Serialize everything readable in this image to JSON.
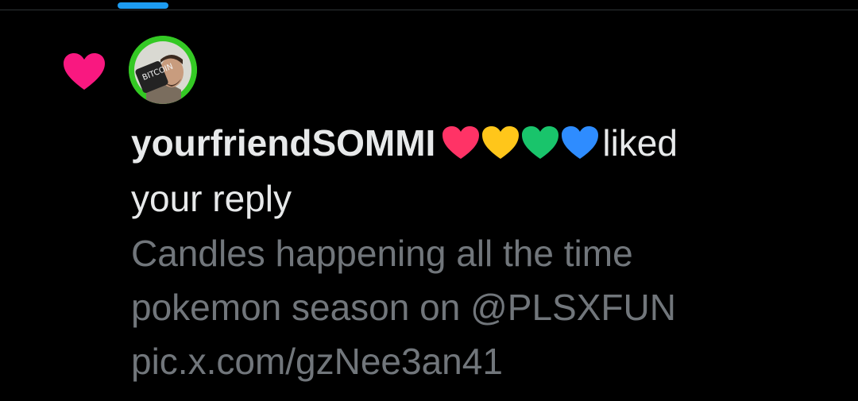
{
  "notification": {
    "user": {
      "name": "yourfriendSOMMI",
      "name_emojis": [
        "red-heart",
        "yellow-heart",
        "green-heart",
        "blue-heart"
      ],
      "avatar": {
        "text": "BITCOIN",
        "ring_color": "#34c924"
      }
    },
    "action_liked": "liked",
    "action_object": "your reply",
    "reply_lines": [
      "Candles happening all the time",
      "pokemon season on @PLSXFUN",
      "pic.x.com/gzNee3an41"
    ],
    "icon": "heart-icon"
  },
  "colors": {
    "background": "#000000",
    "primary_text": "#e7e9ea",
    "secondary_text": "#71767b",
    "like_pink": "#f91880",
    "tab_indicator": "#1d9bf0",
    "divider": "#2f3336"
  }
}
